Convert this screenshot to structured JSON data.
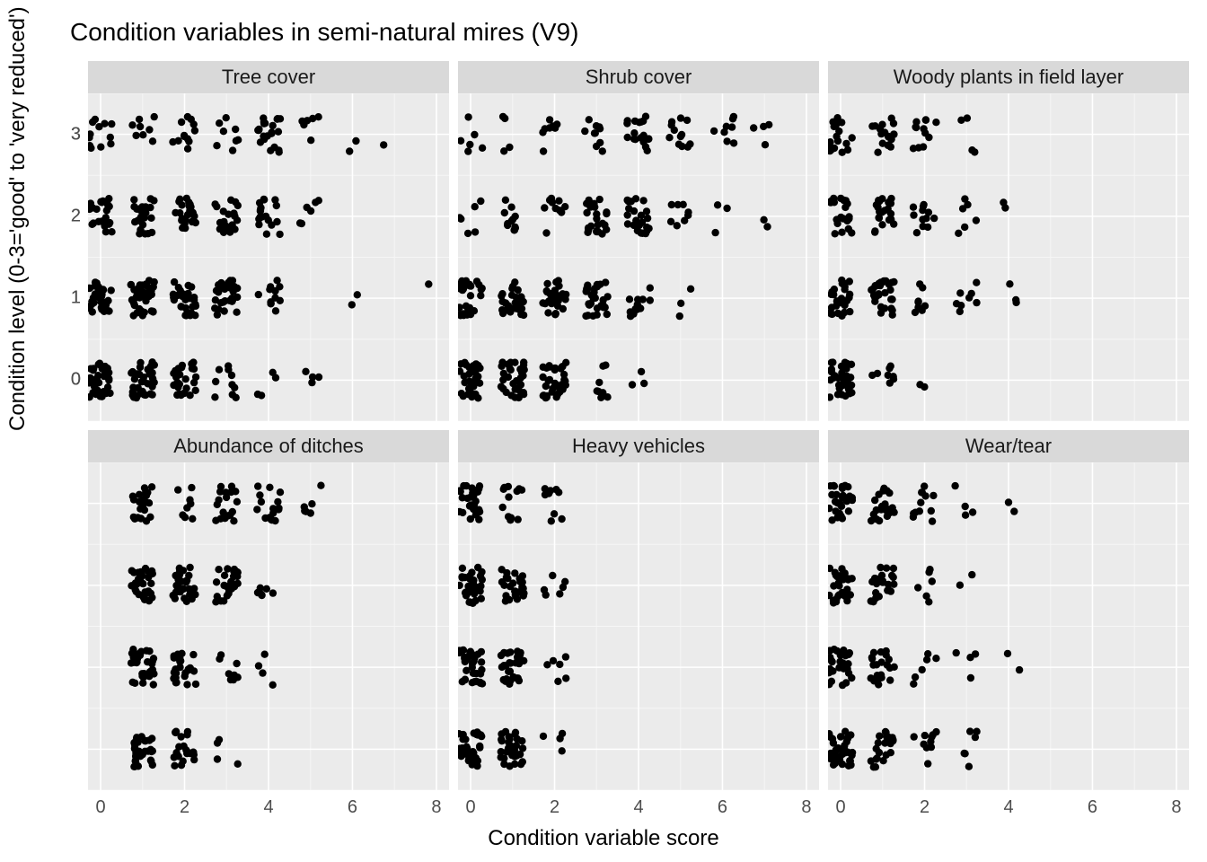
{
  "chart_data": {
    "type": "scatter",
    "title": "Condition variables in semi-natural mires (V9)",
    "xlabel": "Condition variable score",
    "ylabel": "Condition level (0-3='good' to 'very reduced')",
    "xlim": [
      -0.3,
      8.3
    ],
    "ylim": [
      -0.5,
      3.5
    ],
    "x_breaks": [
      0,
      2,
      4,
      6,
      8
    ],
    "y_breaks": [
      0,
      1,
      2,
      3
    ],
    "note": "Jittered scatter with categorical y. Counts approximated by visual density.",
    "facets": [
      {
        "name": "Tree cover",
        "counts": {
          "0": {
            "0": 35,
            "1": 35,
            "2": 30,
            "3": 10,
            "4": 4,
            "5": 4
          },
          "1": {
            "0": 35,
            "1": 35,
            "2": 35,
            "3": 30,
            "4": 12,
            "6": 2,
            "8": 1
          },
          "2": {
            "0": 25,
            "1": 25,
            "2": 25,
            "3": 22,
            "4": 18,
            "5": 6
          },
          "3": {
            "0": 12,
            "1": 8,
            "2": 12,
            "3": 8,
            "4": 22,
            "5": 6,
            "6": 2,
            "7": 1
          }
        }
      },
      {
        "name": "Shrub cover",
        "counts": {
          "0": {
            "0": 35,
            "1": 35,
            "2": 35,
            "3": 8,
            "4": 3
          },
          "1": {
            "0": 30,
            "1": 30,
            "2": 30,
            "3": 28,
            "4": 12,
            "5": 3
          },
          "2": {
            "0": 6,
            "1": 12,
            "2": 10,
            "3": 25,
            "4": 25,
            "5": 8,
            "6": 3,
            "7": 2
          },
          "3": {
            "0": 6,
            "1": 4,
            "2": 8,
            "3": 10,
            "4": 18,
            "5": 12,
            "6": 8,
            "7": 4
          }
        }
      },
      {
        "name": "Woody plants in field layer",
        "counts": {
          "0": {
            "0": 35,
            "1": 8,
            "2": 2
          },
          "1": {
            "0": 30,
            "1": 30,
            "2": 8,
            "3": 8,
            "4": 3
          },
          "2": {
            "0": 22,
            "1": 22,
            "2": 12,
            "3": 6,
            "4": 2
          },
          "3": {
            "0": 18,
            "1": 18,
            "2": 12,
            "3": 4
          }
        }
      },
      {
        "name": "Abundance of ditches",
        "counts": {
          "0": {
            "1": 35,
            "2": 22,
            "3": 4
          },
          "1": {
            "1": 35,
            "2": 28,
            "3": 8,
            "4": 4
          },
          "2": {
            "1": 35,
            "2": 28,
            "3": 25,
            "4": 6
          },
          "3": {
            "1": 22,
            "2": 8,
            "3": 18,
            "4": 18,
            "5": 6
          }
        }
      },
      {
        "name": "Heavy vehicles",
        "counts": {
          "0": {
            "0": 35,
            "1": 30,
            "2": 4
          },
          "1": {
            "0": 35,
            "1": 30,
            "2": 6
          },
          "2": {
            "0": 35,
            "1": 28,
            "2": 6
          },
          "3": {
            "0": 28,
            "1": 12,
            "2": 10
          }
        }
      },
      {
        "name": "Wear/tear",
        "counts": {
          "0": {
            "0": 35,
            "1": 22,
            "2": 10,
            "3": 6
          },
          "1": {
            "0": 30,
            "1": 22,
            "2": 6,
            "3": 4,
            "4": 2
          },
          "2": {
            "0": 28,
            "1": 22,
            "2": 6,
            "3": 2
          },
          "3": {
            "0": 28,
            "1": 22,
            "2": 12,
            "3": 4,
            "4": 2
          }
        }
      }
    ]
  }
}
